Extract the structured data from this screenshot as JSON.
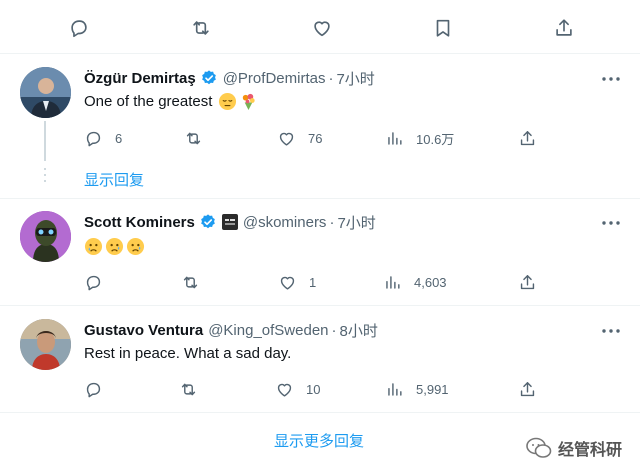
{
  "colors": {
    "accent": "#1d9bf0",
    "text": "#0f1419",
    "muted": "#536471",
    "divider": "#eff3f4"
  },
  "top_actions": [
    "reply-icon",
    "retweet-icon",
    "like-icon",
    "bookmark-icon",
    "share-icon"
  ],
  "tweets": [
    {
      "name": "Özgür Demirtaş",
      "handle": "@ProfDemirtas",
      "separator": "·",
      "time": "7小时",
      "text": "One of the greatest",
      "emojis": [
        "pensive-face",
        "bouquet"
      ],
      "replies": "6",
      "retweets": "",
      "likes": "76",
      "views": "10.6万"
    },
    {
      "name": "Scott Kominers",
      "handle": "@skominers",
      "separator": "·",
      "time": "7小时",
      "text": "",
      "emojis": [
        "crying-face",
        "sad-relieved-face",
        "sad-relieved-face"
      ],
      "replies": "",
      "retweets": "",
      "likes": "1",
      "views": "4,603"
    },
    {
      "name": "Gustavo Ventura",
      "handle": "@King_ofSweden",
      "separator": "·",
      "time": "8小时",
      "text": "Rest in peace. What a sad day.",
      "emojis": [],
      "replies": "",
      "retweets": "",
      "likes": "10",
      "views": "5,991"
    }
  ],
  "show_replies_label": "显示回复",
  "show_more_replies_label": "显示更多回复",
  "watermark": "经管科研"
}
